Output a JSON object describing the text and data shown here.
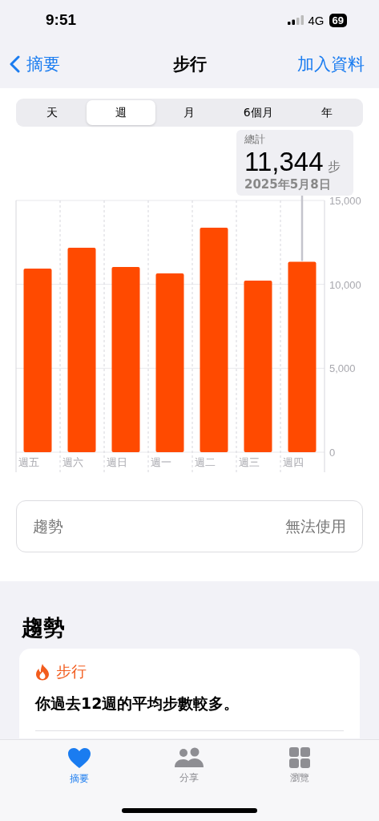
{
  "status_bar": {
    "time": "9:51",
    "network": "4G",
    "battery": "69"
  },
  "nav": {
    "back": "摘要",
    "title": "步行",
    "action": "加入資料"
  },
  "segments": [
    {
      "label": "天",
      "selected": false
    },
    {
      "label": "週",
      "selected": true
    },
    {
      "label": "月",
      "selected": false
    },
    {
      "label": "6個月",
      "selected": false
    },
    {
      "label": "年",
      "selected": false
    }
  ],
  "tooltip": {
    "label": "總計",
    "value": "11,344",
    "unit": "步",
    "date": "2025年5月8日"
  },
  "chart": {
    "chart_data": {
      "type": "bar",
      "categories": [
        "週五",
        "週六",
        "週日",
        "週一",
        "週二",
        "週三",
        "週四"
      ],
      "series": [
        {
          "color": "#ff4a00",
          "values": [
            10940,
            12180,
            11040,
            10650,
            13380,
            10220,
            11344
          ]
        }
      ],
      "ylim": [
        0,
        15000
      ],
      "yticks": [
        {
          "value": 0,
          "label": "0"
        },
        {
          "value": 5000,
          "label": "5,000"
        },
        {
          "value": 10000,
          "label": "10,000"
        },
        {
          "value": 15000,
          "label": "15,000"
        }
      ]
    }
  },
  "trend_row": {
    "label": "趨勢",
    "value": "無法使用"
  },
  "trends": {
    "heading": "趨勢",
    "card": {
      "title": "步行",
      "text": "你過去12週的平均步數較多。"
    }
  },
  "tab_bar": [
    {
      "label": "摘要",
      "kind": "heart",
      "selected": true
    },
    {
      "label": "分享",
      "kind": "people",
      "selected": false
    },
    {
      "label": "瀏覽",
      "kind": "grid",
      "selected": false
    }
  ]
}
